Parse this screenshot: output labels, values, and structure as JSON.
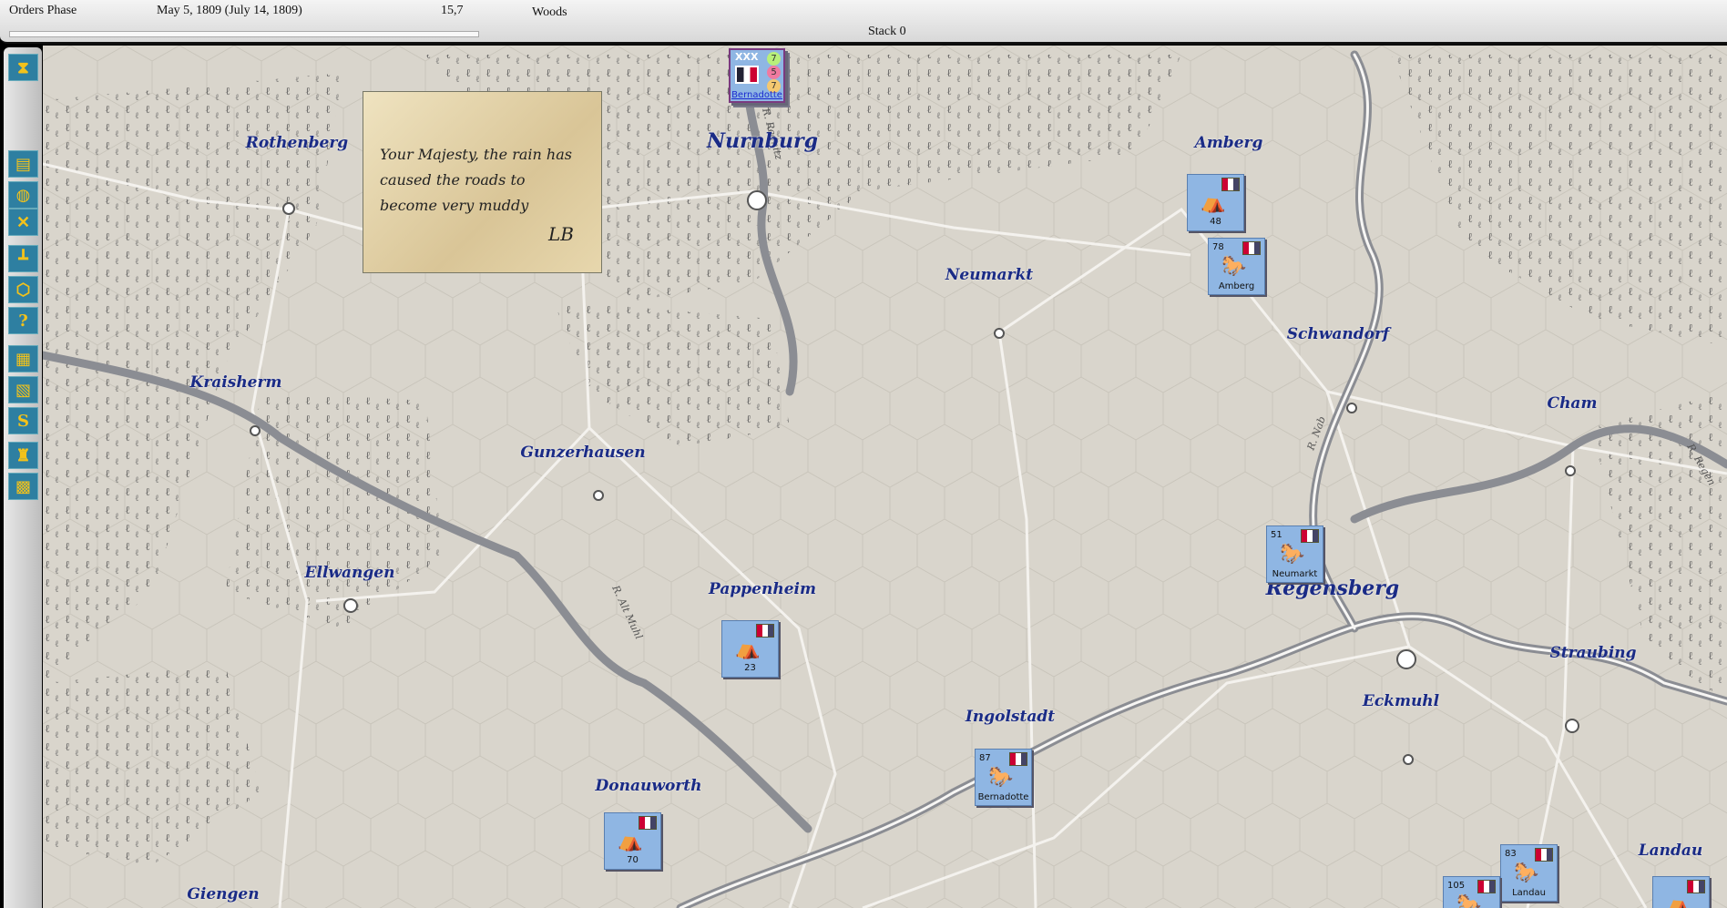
{
  "topbar": {
    "phase": "Orders Phase",
    "date": "May 5, 1809 (July 14, 1809)",
    "coords": "15,7",
    "terrain": "Woods",
    "stack": "Stack 0"
  },
  "toolbar": [
    {
      "icon": "hourglass-icon"
    },
    {
      "icon": "orders-scroll-icon"
    },
    {
      "icon": "supply-barrels-icon"
    },
    {
      "icon": "crossed-sabres-icon"
    },
    {
      "icon": "org-chart-icon"
    },
    {
      "icon": "hex-nut-icon"
    },
    {
      "icon": "help-icon"
    },
    {
      "icon": "ledger-in-icon"
    },
    {
      "icon": "ledger-out-icon"
    },
    {
      "icon": "money-icon"
    },
    {
      "icon": "trophy-icon"
    },
    {
      "icon": "grid-map-icon"
    }
  ],
  "letter": {
    "text": "Your Majesty, the rain has caused the roads to become very muddy",
    "signature": "LB"
  },
  "stack_counter": {
    "size": "XXX",
    "values": [
      "7",
      "5",
      "7"
    ],
    "name": "Bernadotte"
  },
  "cities": [
    "Rothenberg",
    "Nurnburg",
    "Amberg",
    "Neumarkt",
    "Schwandorf",
    "Kraisherm",
    "Cham",
    "Gunzerhausen",
    "Ellwangen",
    "Pappenheim",
    "Regensberg",
    "Straubing",
    "Eckmuhl",
    "Ingolstadt",
    "Donauworth",
    "Landau",
    "Giengen"
  ],
  "rivers": [
    "R. Rednitz",
    "R. Nab",
    "R. Alt Muhl",
    "R. Regen"
  ],
  "units": [
    {
      "type": "depot",
      "value": "48"
    },
    {
      "type": "wagon",
      "value": "78",
      "label": "Amberg"
    },
    {
      "type": "wagon",
      "value": "51",
      "label": "Neumarkt"
    },
    {
      "type": "depot",
      "value": "23"
    },
    {
      "type": "wagon",
      "value": "87",
      "label": "Bernadotte"
    },
    {
      "type": "depot",
      "value": "70"
    },
    {
      "type": "wagon",
      "value": "83",
      "label": "Landau"
    },
    {
      "type": "wagon",
      "value": "105"
    }
  ]
}
